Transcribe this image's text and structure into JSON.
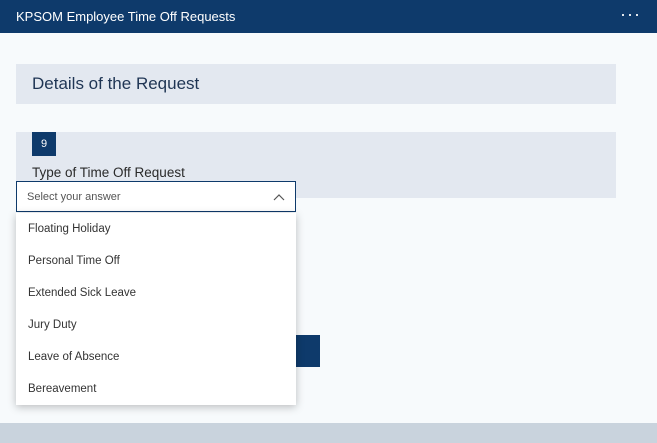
{
  "window": {
    "title": "KPSOM Employee Time Off Requests",
    "more_icon": "···"
  },
  "section": {
    "title": "Details of the Request"
  },
  "question": {
    "number": "9",
    "label": "Type of Time Off Request",
    "placeholder": "Select your answer",
    "options": [
      "Floating Holiday",
      "Personal Time Off",
      "Extended Sick Leave",
      "Jury Duty",
      "Leave of Absence",
      "Bereavement"
    ]
  },
  "colors": {
    "brand": "#0e3a6b",
    "header_bg": "#e3e8f0",
    "page_bg": "#f7fafc"
  }
}
